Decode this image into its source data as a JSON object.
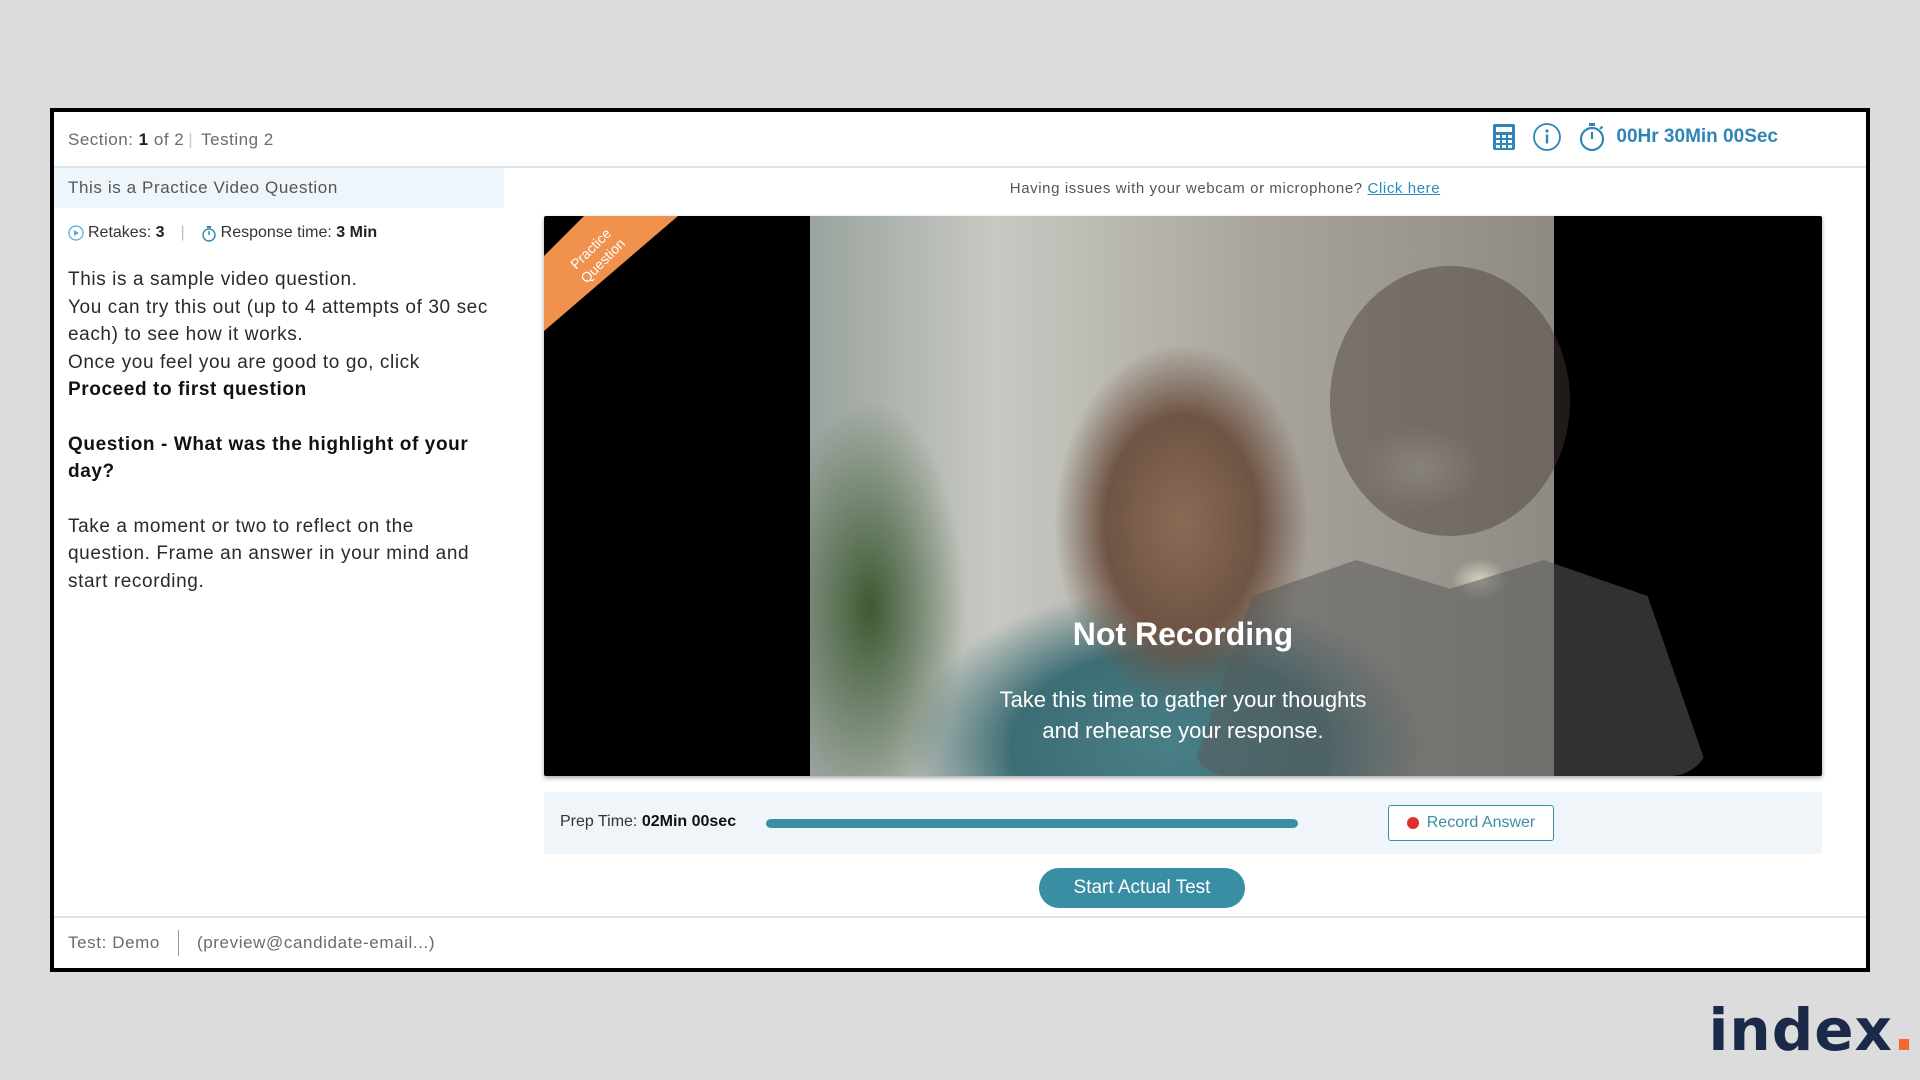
{
  "header": {
    "section_label": "Section:",
    "section_current": "1",
    "section_of": "of 2",
    "section_name": "Testing 2",
    "timer": "00Hr 30Min 00Sec"
  },
  "question": {
    "title": "This is a Practice Video Question",
    "retakes_label": "Retakes:",
    "retakes_value": "3",
    "response_label": "Response time:",
    "response_value": "3 Min",
    "line1": "This is a sample video question.",
    "line2": "You can try this out (up to 4 attempts of 30 sec each) to see how it works.",
    "line3": "Once you feel you are good to go, click",
    "line3_bold": "Proceed to first question",
    "question_text": "Question - What was the highlight of your day?",
    "reflect": "Take a moment or two to reflect on the question. Frame an answer in your mind and start recording."
  },
  "help": {
    "text": "Having issues with your webcam or microphone?",
    "link": "Click here"
  },
  "video": {
    "ribbon_line1": "Practice",
    "ribbon_line2": "Question",
    "ribbon_color": "#f0914d",
    "status": "Not Recording",
    "sub_line1": "Take this time to gather your thoughts",
    "sub_line2": "and rehearse your response."
  },
  "controls": {
    "prep_label": "Prep Time:",
    "prep_value": "02Min  00sec",
    "prep_progress_fraction": 1.0,
    "record_label": "Record Answer",
    "start_label": "Start Actual Test"
  },
  "footer": {
    "test": "Test: Demo",
    "email": "(preview@candidate-email...)"
  },
  "brand": {
    "name": "index",
    "dot": ".",
    "accent": "#f26a2e"
  },
  "colors": {
    "primary": "#3a8ea3",
    "timer": "#2f86b6"
  }
}
